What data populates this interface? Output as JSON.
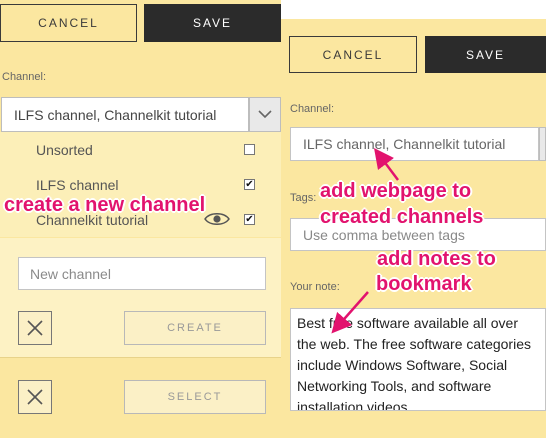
{
  "left_panel": {
    "cancel_label": "CANCEL",
    "save_label": "SAVE",
    "channel_label": "Channel:",
    "channel_value": "ILFS channel, Channelkit tutorial",
    "channel_options": [
      {
        "label": "Unsorted",
        "checked": false
      },
      {
        "label": "ILFS channel",
        "checked": true
      },
      {
        "label": "Channelkit tutorial",
        "checked": true
      }
    ],
    "new_channel_placeholder": "New channel",
    "create_label": "CREATE",
    "select_label": "SELECT"
  },
  "right_panel": {
    "cancel_label": "CANCEL",
    "save_label": "SAVE",
    "channel_label": "Channel:",
    "channel_value": "ILFS channel, Channelkit tutorial",
    "tags_label": "Tags:",
    "tags_placeholder": "Use comma between tags",
    "note_label": "Your note:",
    "note_text": "Best free software available all over the web. The free software categories include Windows Software, Social Networking Tools, and software installation videos."
  },
  "annotations": {
    "create_channel": "create a new channel",
    "add_webpage_line1": "add webpage to",
    "add_webpage_line2": "created channels",
    "add_notes_line1": "add notes to",
    "add_notes_line2": "bookmark"
  },
  "colors": {
    "panel_bg": "#fbe7a0",
    "save_bg": "#2b2b2b",
    "annotation": "#e2136e"
  },
  "icons": {
    "dropdown": "chevron-down-icon",
    "visibility": "eye-icon",
    "close": "close-icon",
    "checkbox_checked": "checkmark-icon"
  }
}
